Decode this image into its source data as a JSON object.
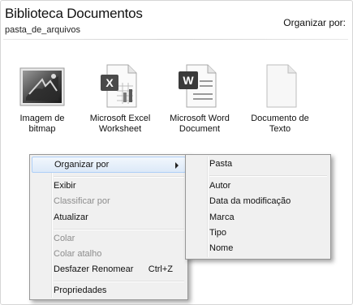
{
  "header": {
    "title": "Biblioteca Documentos",
    "subtitle": "pasta_de_arquivos",
    "organize_label": "Organizar por:"
  },
  "files": [
    {
      "icon": "bitmap-image-icon",
      "line1": "Imagem de",
      "line2": "bitmap"
    },
    {
      "icon": "excel-worksheet-icon",
      "line1": "Microsoft Excel",
      "line2": "Worksheet"
    },
    {
      "icon": "word-document-icon",
      "line1": "Microsoft Word",
      "line2": "Document"
    },
    {
      "icon": "text-document-icon",
      "line1": "Documento de",
      "line2": "Texto"
    }
  ],
  "context_menu": {
    "items": [
      {
        "label": "Organizar por",
        "submenu": true,
        "highlighted": true
      },
      {
        "label": "Exibir"
      },
      {
        "label": "Classificar por",
        "disabled": true
      },
      {
        "label": "Atualizar"
      },
      {
        "label": "Colar",
        "disabled": true
      },
      {
        "label": "Colar atalho",
        "disabled": true
      },
      {
        "label": "Desfazer Renomear",
        "shortcut": "Ctrl+Z"
      },
      {
        "label": "Propriedades"
      }
    ]
  },
  "submenu": {
    "items": [
      {
        "label": "Pasta"
      },
      {
        "label": "Autor"
      },
      {
        "label": "Data da modificação"
      },
      {
        "label": "Marca"
      },
      {
        "label": "Tipo"
      },
      {
        "label": "Nome"
      }
    ]
  },
  "colors": {
    "highlight_bg": "#dce9f8",
    "highlight_border": "#aecff7",
    "menu_bg": "#f0f0f0",
    "disabled_text": "#8d8d8d"
  }
}
